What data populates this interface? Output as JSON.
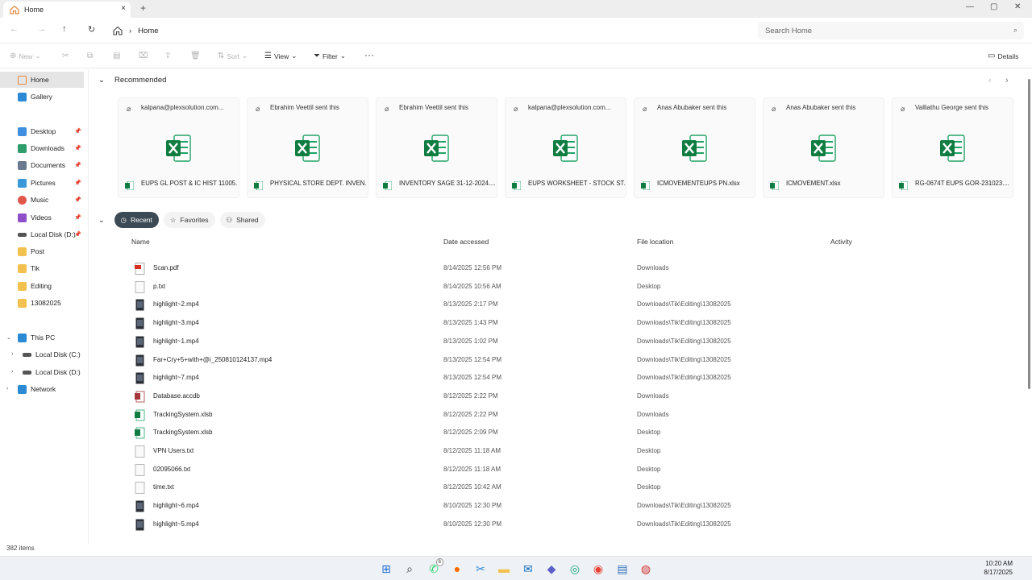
{
  "window": {
    "tab_title": "Home",
    "tab_close": "×",
    "new_tab": "+",
    "controls": [
      "—",
      "▢",
      "✕"
    ]
  },
  "address": {
    "breadcrumb": "Home",
    "search_placeholder": "Search Home"
  },
  "toolbar": {
    "new": "New",
    "sort": "Sort",
    "view": "View",
    "filter": "Filter",
    "more": "···",
    "details": "Details"
  },
  "sidebar": {
    "items": [
      {
        "label": "Home",
        "icon": "home-icon",
        "color": "#e8883a"
      },
      {
        "label": "Gallery",
        "icon": "gallery-icon",
        "color": "#2a8ad4"
      },
      {
        "label": "Desktop",
        "icon": "desktop-icon",
        "color": "#3f8fe0"
      },
      {
        "label": "Downloads",
        "icon": "download-icon",
        "color": "#2e9d6a"
      },
      {
        "label": "Documents",
        "icon": "document-icon",
        "color": "#6b7a8f"
      },
      {
        "label": "Pictures",
        "icon": "pictures-icon",
        "color": "#3a9ad9"
      },
      {
        "label": "Music",
        "icon": "music-icon",
        "color": "#e1584b"
      },
      {
        "label": "Videos",
        "icon": "videos-icon",
        "color": "#8e4fc9"
      },
      {
        "label": "Local Disk (D:)",
        "icon": "drive-icon",
        "color": "#555555"
      },
      {
        "label": "Post",
        "icon": "folder-icon",
        "color": "#f2c14e"
      },
      {
        "label": "Tik",
        "icon": "folder-icon",
        "color": "#f2c14e"
      },
      {
        "label": "Editing",
        "icon": "folder-icon",
        "color": "#f2c14e"
      },
      {
        "label": "13082025",
        "icon": "folder-icon",
        "color": "#f2c14e"
      },
      {
        "label": "This PC",
        "icon": "pc-icon",
        "color": "#2a8ad4"
      },
      {
        "label": "Local Disk (C:)",
        "icon": "drive-icon",
        "color": "#555555"
      },
      {
        "label": "Local Disk (D:)",
        "icon": "drive-icon",
        "color": "#555555"
      },
      {
        "label": "Network",
        "icon": "network-icon",
        "color": "#2a8ad4"
      }
    ]
  },
  "recommended": {
    "title": "Recommended",
    "cards": [
      {
        "sender": "kalpana@plexsolution.com...",
        "file": "EUPS GL POST & IC HIST 11005..."
      },
      {
        "sender": "Ebrahim Veettil sent this",
        "file": "PHYSICAL STORE DEPT. INVEN..."
      },
      {
        "sender": "Ebrahim Veettil sent this",
        "file": "INVENTORY SAGE 31-12-2024...."
      },
      {
        "sender": "kalpana@plexsolution.com...",
        "file": "EUPS WORKSHEET - STOCK ST..."
      },
      {
        "sender": "Anas Abubaker sent this",
        "file": "ICMOVEMENTEUPS PN.xlsx"
      },
      {
        "sender": "Anas Abubaker sent this",
        "file": "ICMOVEMENT.xlsx"
      },
      {
        "sender": "Valliathu George sent this",
        "file": "RG-0674T EUPS GOR-231023...."
      }
    ]
  },
  "pivots": {
    "recent": "Recent",
    "favorites": "Favorites",
    "shared": "Shared"
  },
  "columns": {
    "name": "Name",
    "date": "Date accessed",
    "location": "File location",
    "activity": "Activity"
  },
  "files": [
    {
      "name": "Scan.pdf",
      "date": "8/14/2025 12:56 PM",
      "location": "Downloads",
      "type": "pdf"
    },
    {
      "name": "p.txt",
      "date": "8/14/2025 10:56 AM",
      "location": "Desktop",
      "type": "txt"
    },
    {
      "name": "highlight~2.mp4",
      "date": "8/13/2025 2:17 PM",
      "location": "Downloads\\Tik\\Editing\\13082025",
      "type": "mp4"
    },
    {
      "name": "highlight~3.mp4",
      "date": "8/13/2025 1:43 PM",
      "location": "Downloads\\Tik\\Editing\\13082025",
      "type": "mp4"
    },
    {
      "name": "highlight~1.mp4",
      "date": "8/13/2025 1:02 PM",
      "location": "Downloads\\Tik\\Editing\\13082025",
      "type": "mp4"
    },
    {
      "name": "Far+Cry+5+with+@i_250810124137.mp4",
      "date": "8/13/2025 12:54 PM",
      "location": "Downloads\\Tik\\Editing\\13082025",
      "type": "mp4"
    },
    {
      "name": "highlight~7.mp4",
      "date": "8/13/2025 12:54 PM",
      "location": "Downloads\\Tik\\Editing\\13082025",
      "type": "mp4"
    },
    {
      "name": "Database.accdb",
      "date": "8/12/2025 2:22 PM",
      "location": "Downloads",
      "type": "accdb"
    },
    {
      "name": "TrackingSystem.xlsb",
      "date": "8/12/2025 2:22 PM",
      "location": "Downloads",
      "type": "xlsx"
    },
    {
      "name": "TrackingSystem.xlsb",
      "date": "8/12/2025 2:09 PM",
      "location": "Desktop",
      "type": "xlsx"
    },
    {
      "name": "VPN Users.txt",
      "date": "8/12/2025 11:18 AM",
      "location": "Desktop",
      "type": "txt"
    },
    {
      "name": "02095066.txt",
      "date": "8/12/2025 11:18 AM",
      "location": "Desktop",
      "type": "txt"
    },
    {
      "name": "time.txt",
      "date": "8/12/2025 10:42 AM",
      "location": "Desktop",
      "type": "txt"
    },
    {
      "name": "highlight~6.mp4",
      "date": "8/10/2025 12:30 PM",
      "location": "Downloads\\Tik\\Editing\\13082025",
      "type": "mp4"
    },
    {
      "name": "highlight~5.mp4",
      "date": "8/10/2025 12:30 PM",
      "location": "Downloads\\Tik\\Editing\\13082025",
      "type": "mp4"
    }
  ],
  "status": {
    "count": "382 items"
  },
  "taskbar": {
    "apps": [
      "start-icon",
      "search-icon",
      "whatsapp-icon",
      "firefox-icon",
      "snipping-icon",
      "file-explorer-icon",
      "outlook-icon",
      "teams-icon",
      "edge-icon",
      "chrome-icon",
      "notepad-icon",
      "app-icon"
    ],
    "badge": "6",
    "time": "10:20 AM",
    "date": "8/17/2025"
  }
}
